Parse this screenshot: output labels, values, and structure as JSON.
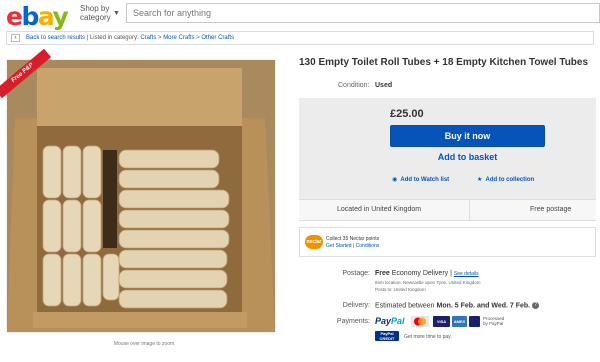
{
  "header": {
    "logo_letters": [
      "e",
      "b",
      "a",
      "y"
    ],
    "shop_by_line1": "Shop by",
    "shop_by_line2": "category",
    "search_placeholder": "Search for anything"
  },
  "breadcrumb": {
    "back_label": "Back to search results",
    "listed_in": "Listed in category:",
    "items": [
      "Crafts",
      "More Crafts",
      "Other Crafts"
    ],
    "separator": ">"
  },
  "product_image": {
    "badge": "Free P&P",
    "caption": "Mouse over image to zoom"
  },
  "listing": {
    "title": "130 Empty Toilet Roll Tubes + 18 Empty Kitchen Towel Tubes",
    "condition_label": "Condition:",
    "condition_value": "Used",
    "price": "£25.00",
    "buy_label": "Buy it now",
    "basket_label": "Add to basket",
    "watch_label": "Add to Watch list",
    "collection_label": "Add to collection",
    "location": "Located in United Kingdom",
    "free_postage": "Free postage"
  },
  "nectar": {
    "badge": "nectar",
    "line1": "Collect 35 Nectar points",
    "get_started": "Get Started",
    "conditions": "Conditions"
  },
  "details": {
    "postage_label": "Postage:",
    "postage_free": "Free",
    "postage_service": "Economy Delivery",
    "see_details": "See details",
    "item_location": "Item location:  Newcastle upon Tyne, United Kingdom",
    "posts_to": "Posts to:  United Kingdom",
    "delivery_label": "Delivery:",
    "delivery_prefix": "Estimated between",
    "delivery_dates": "Mon. 5 Feb. and Wed. 7 Feb.",
    "payments_label": "Payments:",
    "paypal_pay": "Pay",
    "paypal_pal": "Pal",
    "card_visa": "VISA",
    "card_amex": "AMEX",
    "processed_line1": "Processed",
    "processed_line2": "by PayPal",
    "credit_line1": "PayPal",
    "credit_line2": "CREDIT",
    "more_time": "Get more time to pay."
  },
  "colors": {
    "ebay_red": "#e53238",
    "ebay_blue": "#0064d2",
    "ebay_yellow": "#f5af02",
    "ebay_green": "#86b817",
    "buy_button": "#0654ba",
    "link": "#0654ba",
    "nectar_orange": "#f39200",
    "badge_red": "#d81e2a",
    "cardboard": "#c9a571"
  }
}
